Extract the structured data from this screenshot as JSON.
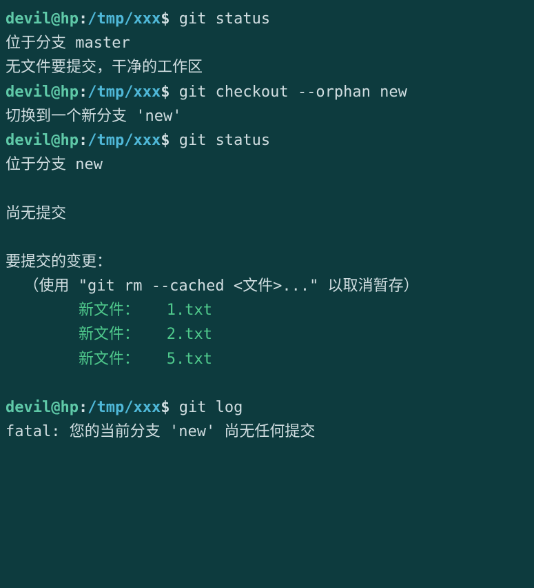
{
  "prompt": {
    "user": "devil",
    "at": "@",
    "host": "hp",
    "sep": ":",
    "path": "/tmp/xxx",
    "dollar": "$"
  },
  "lines": [
    {
      "type": "prompt",
      "cmd": "git status"
    },
    {
      "type": "output",
      "text": "位于分支 master"
    },
    {
      "type": "output",
      "text": "无文件要提交，干净的工作区"
    },
    {
      "type": "prompt",
      "cmd": "git checkout --orphan new"
    },
    {
      "type": "output",
      "text": "切换到一个新分支 'new'"
    },
    {
      "type": "prompt",
      "cmd": "git status"
    },
    {
      "type": "output",
      "text": "位于分支 new"
    },
    {
      "type": "blank"
    },
    {
      "type": "output",
      "text": "尚无提交"
    },
    {
      "type": "blank"
    },
    {
      "type": "output",
      "text": "要提交的变更："
    },
    {
      "type": "output",
      "text": "  （使用 \"git rm --cached <文件>...\" 以取消暂存）"
    },
    {
      "type": "green",
      "label": "新文件：",
      "file": "1.txt"
    },
    {
      "type": "green",
      "label": "新文件：",
      "file": "2.txt"
    },
    {
      "type": "green",
      "label": "新文件：",
      "file": "5.txt"
    },
    {
      "type": "blank"
    },
    {
      "type": "prompt",
      "cmd": "git log"
    },
    {
      "type": "output",
      "text": "fatal: 您的当前分支 'new' 尚无任何提交"
    }
  ]
}
